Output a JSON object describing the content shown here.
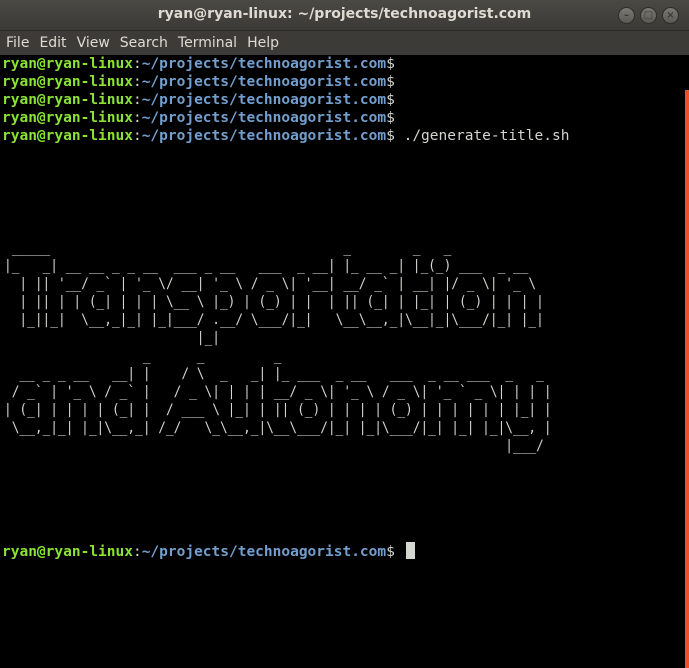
{
  "window": {
    "title": "ryan@ryan-linux: ~/projects/technoagorist.com",
    "buttons": {
      "minimize": "–",
      "maximize": "□",
      "close": "×"
    }
  },
  "menu": [
    "File",
    "Edit",
    "View",
    "Search",
    "Terminal",
    "Help"
  ],
  "terminal": {
    "user_host": "ryan@ryan-linux",
    "sep": ":",
    "path": "~/projects/technoagorist.com",
    "prompt_char": "$",
    "command": " ./generate-title.sh",
    "banner_line1": " _____                                      _        _   _             \n|_   _| __ __ _ _ __  ___ _ __   ___  _ __| |_ __ _| |_(_) ___  _ __  \n  | || '__/ _` | '_ \\/ __| '_ \\ / _ \\| '__| __/ _` | __| |/ _ \\| '_ \\ \n  | || | | (_| | | | \\__ \\ |_) | (_) | |  | || (_| | |_| | (_) | | | |\n  |_||_|  \\__,_|_| |_|___/ .__/ \\___/|_|   \\__\\__,_|\\__|_|\\___/|_| |_|\n                         |_|                                          ",
    "banner_line2": "                  _      _         _                                    \n  __ _ _ __   __| |    / \\  _   _| |_ ___  _ __   ___  _ __ ___  _   _ \n / _` | '_ \\ / _` |   / _ \\| | | | __/ _ \\| '_ \\ / _ \\| '_ ` _ \\| | | |\n| (_| | | | | (_| |  / ___ \\ |_| | || (_) | | | | (_) | | | | | | |_| |\n \\__,_|_| |_|\\__,_| /_/   \\_\\__,_|\\__\\___/|_| |_|\\___/|_| |_| |_|\\__, |\n                                                                 |___/ "
  },
  "colors": {
    "prompt_user": "#8ae234",
    "prompt_path": "#729fcf",
    "scrollbar": "#e95420"
  }
}
